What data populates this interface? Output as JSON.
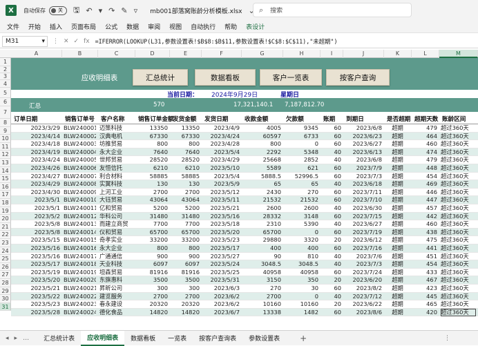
{
  "titlebar": {
    "logo": "X",
    "autosave_label": "自动保存",
    "autosave_state": "关",
    "filename": "mb001部落窝账龄分析模板.xlsx",
    "search_placeholder": "搜索"
  },
  "menu": [
    "文件",
    "开始",
    "插入",
    "页面布局",
    "公式",
    "数据",
    "审阅",
    "视图",
    "自动执行",
    "帮助",
    "表设计"
  ],
  "formula_bar": {
    "name_box": "M31",
    "fx": "fx",
    "formula": "=IFERROR(LOOKUP(L31,参数设置表!$B$8:$B$11,参数设置表!$C$8:$C$11),\"未超期\")"
  },
  "columns": [
    "A",
    "B",
    "C",
    "D",
    "E",
    "F",
    "G",
    "H",
    "I",
    "J",
    "K",
    "L",
    "M"
  ],
  "row_numbers": [
    "1",
    "2",
    "3",
    "4",
    "5",
    "6",
    "7",
    "8",
    "9",
    "10",
    "11",
    "12",
    "13",
    "14",
    "15",
    "16",
    "17",
    "18",
    "19",
    "20",
    "21",
    "22",
    "23",
    "24",
    "25",
    "26",
    "27",
    "28",
    "29",
    "30",
    "31"
  ],
  "banner": {
    "title": "应收明细表",
    "buttons": [
      "汇总统计",
      "数据看板",
      "客户一览表",
      "按客户查询"
    ]
  },
  "date_row": {
    "label": "当前日期：",
    "date": "2024年9月29日",
    "weekday": "星期日"
  },
  "total_row": {
    "label": "汇总",
    "count": "570",
    "received": "17,321,140.1",
    "owed": "7,187,812.70"
  },
  "headers": [
    "订单日期",
    "销售订单号",
    "客户名称",
    "销售订单金额",
    "发货金额",
    "发货日期",
    "收款金额",
    "欠款额",
    "账期",
    "到期日",
    "是否超期",
    "超期天数",
    "账龄区间"
  ],
  "rows": [
    [
      "2023/3/29",
      "BLW240001",
      "迈策科技",
      "13350",
      "13350",
      "2023/4/9",
      "4005",
      "9345",
      "60",
      "2023/6/8",
      "超期",
      "479",
      "超过360天"
    ],
    [
      "2023/4/14",
      "BLW240002",
      "汉典电机",
      "67330",
      "67330",
      "2023/4/24",
      "60597",
      "6733",
      "60",
      "2023/6/23",
      "超期",
      "464",
      "超过360天"
    ],
    [
      "2023/4/18",
      "BLW240003",
      "坊推贸易",
      "800",
      "800",
      "2023/4/28",
      "800",
      "0",
      "60",
      "2023/6/27",
      "超期",
      "460",
      "超过360天"
    ],
    [
      "2023/4/19",
      "BLW240004",
      "永大企业",
      "7640",
      "7640",
      "2023/5/4",
      "2292",
      "5348",
      "40",
      "2023/6/13",
      "超期",
      "474",
      "超过360天"
    ],
    [
      "2023/4/24",
      "BLW240005",
      "世邦贸易",
      "28520",
      "28520",
      "2023/4/29",
      "25668",
      "2852",
      "40",
      "2023/6/8",
      "超期",
      "479",
      "超过360天"
    ],
    [
      "2023/4/26",
      "BLW240006",
      "友恒信托",
      "6210",
      "6210",
      "2023/5/10",
      "5589",
      "621",
      "60",
      "2023/7/9",
      "超期",
      "448",
      "超过360天"
    ],
    [
      "2023/4/27",
      "BLW240007",
      "利合材料",
      "58885",
      "58885",
      "2023/5/4",
      "5888.5",
      "52996.5",
      "60",
      "2023/7/3",
      "超期",
      "454",
      "超过360天"
    ],
    [
      "2023/4/29",
      "BLW240008",
      "实翼科技",
      "130",
      "130",
      "2023/5/9",
      "65",
      "65",
      "40",
      "2023/6/18",
      "超期",
      "469",
      "超过360天"
    ],
    [
      "2023/4/30",
      "BLW240009",
      "上河工业",
      "2700",
      "2700",
      "2023/5/12",
      "2430",
      "270",
      "60",
      "2023/7/11",
      "超期",
      "446",
      "超过360天"
    ],
    [
      "2023/5/1",
      "BLW240010",
      "大钰贸易",
      "43064",
      "43064",
      "2023/5/11",
      "21532",
      "21532",
      "60",
      "2023/7/10",
      "超期",
      "447",
      "超过360天"
    ],
    [
      "2023/5/1",
      "BLW240011",
      "亿和贸易",
      "5200",
      "5200",
      "2023/5/21",
      "2600",
      "2600",
      "40",
      "2023/6/30",
      "超期",
      "457",
      "超过360天"
    ],
    [
      "2023/5/2",
      "BLW240012",
      "华科公司",
      "31480",
      "31480",
      "2023/5/16",
      "28332",
      "3148",
      "60",
      "2023/7/15",
      "超期",
      "442",
      "超过360天"
    ],
    [
      "2023/5/8",
      "BLW240013",
      "而建立商贸",
      "7700",
      "7700",
      "2023/5/18",
      "2310",
      "5390",
      "40",
      "2023/6/27",
      "超期",
      "460",
      "超过360天"
    ],
    [
      "2023/5/8",
      "BLW240014",
      "仪和贸易",
      "65700",
      "65700",
      "2023/5/20",
      "65700",
      "0",
      "60",
      "2023/7/19",
      "超期",
      "438",
      "超过360天"
    ],
    [
      "2023/5/15",
      "BLW240015",
      "奇孝实业",
      "33200",
      "33200",
      "2023/5/23",
      "29880",
      "3320",
      "20",
      "2023/6/12",
      "超期",
      "475",
      "超过360天"
    ],
    [
      "2023/5/16",
      "BLW240016",
      "永大企业",
      "800",
      "800",
      "2023/5/17",
      "400",
      "400",
      "60",
      "2023/7/16",
      "超期",
      "441",
      "超过360天"
    ],
    [
      "2023/5/16",
      "BLW240017",
      "广通通信",
      "900",
      "900",
      "2023/5/27",
      "90",
      "810",
      "40",
      "2023/7/6",
      "超期",
      "451",
      "超过360天"
    ],
    [
      "2023/5/17",
      "BLW240018",
      "天业科技",
      "6097",
      "6097",
      "2023/5/24",
      "3048.5",
      "3048.5",
      "40",
      "2023/7/3",
      "超期",
      "454",
      "超过360天"
    ],
    [
      "2023/5/19",
      "BLW240019",
      "坦森贸易",
      "81916",
      "81916",
      "2023/5/25",
      "40958",
      "40958",
      "60",
      "2023/7/24",
      "超期",
      "433",
      "超过360天"
    ],
    [
      "2023/5/20",
      "BLW240020",
      "东旗惠科",
      "3500",
      "3500",
      "2023/5/31",
      "3150",
      "350",
      "20",
      "2023/6/20",
      "超期",
      "467",
      "超过360天"
    ],
    [
      "2023/5/21",
      "BLW240021",
      "昇昕公司",
      "300",
      "300",
      "2023/6/3",
      "270",
      "30",
      "60",
      "2023/8/2",
      "超期",
      "423",
      "超过360天"
    ],
    [
      "2023/5/22",
      "BLW240022",
      "建览服务",
      "2700",
      "2700",
      "2023/6/2",
      "2700",
      "0",
      "40",
      "2023/7/12",
      "超期",
      "445",
      "超过360天"
    ],
    [
      "2023/5/23",
      "BLW240023",
      "春永建设",
      "20320",
      "20320",
      "2023/6/2",
      "10160",
      "10160",
      "20",
      "2023/6/22",
      "超期",
      "465",
      "超过360天"
    ],
    [
      "2023/5/28",
      "BLW240024",
      "德化食品",
      "14820",
      "14820",
      "2023/6/7",
      "13338",
      "1482",
      "60",
      "2023/8/6",
      "超期",
      "420",
      "超过360天"
    ]
  ],
  "sheet_tabs": [
    "汇总统计表",
    "应收明细表",
    "数据看板",
    "一览表",
    "按客户查询表",
    "参数设置表"
  ],
  "active_sheet": "应收明细表",
  "colors": {
    "accent": "#1d6f42",
    "banner": "#5d9a8c",
    "band": "#dfeeea"
  }
}
